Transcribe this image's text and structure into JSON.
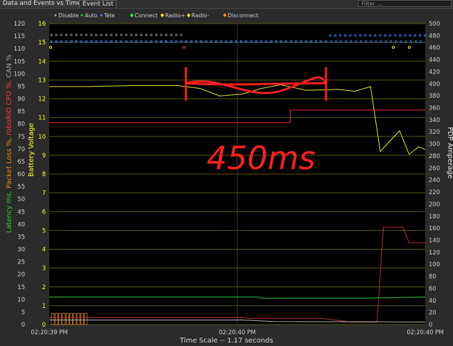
{
  "tabs": [
    {
      "label": "Data and Events vs Time",
      "active": true
    },
    {
      "label": "Event List",
      "active": false
    }
  ],
  "filter": {
    "placeholder": "Filter ..."
  },
  "legend": [
    {
      "label": "Disable",
      "color": "#9a9a9a"
    },
    {
      "label": "Auto",
      "color": "#2ecc40"
    },
    {
      "label": "Tele",
      "color": "#3d8fff"
    },
    {
      "label": "Connect",
      "color": "#33ff33"
    },
    {
      "label": "Radio+",
      "color": "#ffff00"
    },
    {
      "label": "Radio-",
      "color": "#ffff00"
    },
    {
      "label": "Disconnect",
      "color": "#ff8c00"
    }
  ],
  "y_left_axis_title": [
    {
      "text": "Latency ms,",
      "color": "#33cc33"
    },
    {
      "text": " Packet Loss %,",
      "color": "#e08a1e"
    },
    {
      "text": " roboRIO CPU %,",
      "color": "#ff3b3b"
    },
    {
      "text": " CAN %",
      "color": "#a0a0a0"
    }
  ],
  "y_left_axis_title2": {
    "text": "Battery Voltage",
    "color": "#ffff33"
  },
  "y_right_axis_title": "PDP Amperage",
  "x_axis_title": "Time Scale -- 1.17 seconds",
  "annotation": {
    "text": "450ms",
    "color": "#ff2020"
  },
  "chart_data": {
    "type": "line",
    "x_ticks": [
      "02:20:39 PM",
      "02:20:40 PM",
      "02:20:40 PM"
    ],
    "x_range": [
      0,
      1.17
    ],
    "y_left_ticks": [
      0,
      5,
      10,
      15,
      20,
      25,
      30,
      35,
      40,
      45,
      50,
      55,
      60,
      65,
      70,
      75,
      80,
      85,
      90,
      95,
      100,
      105,
      110,
      115,
      120
    ],
    "y_left_range": [
      0,
      120
    ],
    "y_voltage_ticks": [
      0,
      1,
      2,
      3,
      4,
      5,
      6,
      7,
      8,
      9,
      10,
      11,
      12,
      13,
      14,
      15,
      16
    ],
    "y_voltage_range": [
      0,
      16
    ],
    "y_right_ticks": [
      0,
      20,
      40,
      60,
      80,
      100,
      120,
      140,
      160,
      180,
      200,
      220,
      240,
      260,
      280,
      300,
      320,
      340,
      360,
      380,
      400,
      420,
      440,
      460,
      480,
      500
    ],
    "y_right_range": [
      0,
      500
    ],
    "grid": true,
    "series": [
      {
        "name": "Battery Voltage",
        "axis": "voltage",
        "color": "#e8e83a",
        "points": [
          [
            0,
            12.65
          ],
          [
            0.12,
            12.65
          ],
          [
            0.25,
            12.7
          ],
          [
            0.4,
            12.7
          ],
          [
            0.47,
            12.55
          ],
          [
            0.53,
            12.15
          ],
          [
            0.6,
            12.25
          ],
          [
            0.66,
            12.55
          ],
          [
            0.72,
            12.75
          ],
          [
            0.8,
            12.45
          ],
          [
            0.9,
            12.5
          ],
          [
            0.95,
            12.4
          ],
          [
            1.0,
            12.65
          ],
          [
            1.03,
            9.2
          ],
          [
            1.09,
            10.3
          ],
          [
            1.12,
            9.05
          ],
          [
            1.15,
            9.45
          ],
          [
            1.17,
            9.3
          ]
        ]
      },
      {
        "name": "roboRIO CPU %",
        "axis": "left",
        "color": "#ff2a2a",
        "points": [
          [
            0,
            80.5
          ],
          [
            0.75,
            80.5
          ],
          [
            0.75,
            85.5
          ],
          [
            1.17,
            85.5
          ]
        ]
      },
      {
        "name": "PDP Amperage",
        "axis": "right",
        "color": "#c0302a",
        "points": [
          [
            0,
            12
          ],
          [
            0.6,
            12
          ],
          [
            0.62,
            10
          ],
          [
            0.85,
            10
          ],
          [
            0.94,
            4
          ],
          [
            1.02,
            4
          ],
          [
            1.04,
            162
          ],
          [
            1.1,
            162
          ],
          [
            1.12,
            136
          ],
          [
            1.17,
            136
          ]
        ]
      },
      {
        "name": "Latency ms",
        "axis": "left",
        "color": "#2ecc40",
        "points": [
          [
            0,
            11
          ],
          [
            0.65,
            11
          ],
          [
            0.66,
            10.5
          ],
          [
            1.0,
            10.5
          ],
          [
            1.17,
            11
          ]
        ]
      },
      {
        "name": "CAN %",
        "axis": "left",
        "color": "#bbbbbb",
        "points": [
          [
            0,
            1.8
          ],
          [
            0.6,
            1.8
          ],
          [
            0.7,
            1.2
          ],
          [
            1.17,
            1.0
          ]
        ]
      }
    ],
    "events": {
      "disable_row_y": 115.5,
      "tele_row_y": 112.8,
      "packet_loss_bars": 10
    }
  }
}
